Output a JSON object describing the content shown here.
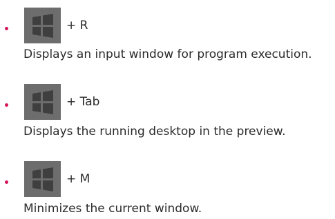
{
  "colors": {
    "bullet": "#d4145a",
    "windows_key": "#6d6d6d",
    "windows_pane": "#545454",
    "text": "#2a2a2a"
  },
  "shortcuts": [
    {
      "icon": "windows-key-icon",
      "key_combo": "+ R",
      "description": "Displays an input window for program execution."
    },
    {
      "icon": "windows-key-icon",
      "key_combo": "+ Tab",
      "description": "Displays the running desktop in the preview."
    },
    {
      "icon": "windows-key-icon",
      "key_combo": "+ M",
      "description": "Minimizes the current window."
    }
  ]
}
